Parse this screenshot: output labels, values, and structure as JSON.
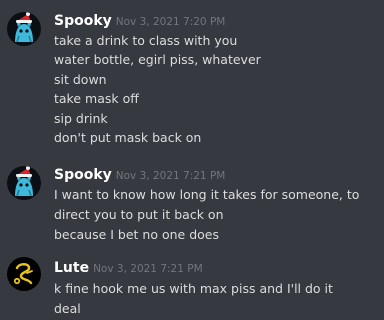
{
  "colors": {
    "background": "#36393f",
    "username": "#ffffff",
    "timestamp": "#72767d",
    "message_text": "#dcddde"
  },
  "messages": [
    {
      "username": "Spooky",
      "timestamp": "Nov 3, 2021 7:20 PM",
      "avatar_icon": "santa-hat-cat-avatar-icon",
      "lines": [
        "take a drink to class with you",
        "water bottle, egirl piss, whatever",
        "sit down",
        "take mask off",
        "sip drink",
        "don't put mask back on"
      ]
    },
    {
      "username": "Spooky",
      "timestamp": "Nov 3, 2021 7:21 PM",
      "avatar_icon": "santa-hat-cat-avatar-icon",
      "lines": [
        "I want to know how long it takes for someone, to",
        "direct you to put it back on",
        "because I bet no one does"
      ]
    },
    {
      "username": "Lute",
      "timestamp": "Nov 3, 2021 7:21 PM",
      "avatar_icon": "yellow-symbol-avatar-icon",
      "lines": [
        "k fine hook me us with max piss and I'll do it",
        "deal"
      ]
    }
  ]
}
